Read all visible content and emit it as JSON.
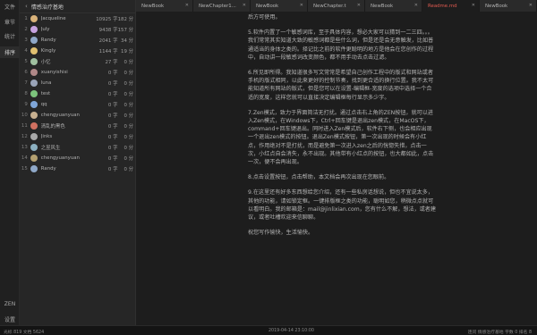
{
  "rail": {
    "items": [
      "文件",
      "章节",
      "统计",
      "排序"
    ],
    "bottom": [
      "ZEN",
      "设置"
    ]
  },
  "panel": {
    "title": "情感治疗基地",
    "rows": [
      {
        "n": "1",
        "name": "Jacqueline",
        "count": "10925 字",
        "time": "182 分",
        "color": "#d9b27a"
      },
      {
        "n": "2",
        "name": "July",
        "count": "9438 字",
        "time": "157 分",
        "color": "#c7a3e0"
      },
      {
        "n": "3",
        "name": "Randy",
        "count": "2041 字",
        "time": "34 分",
        "color": "#8fa8c8"
      },
      {
        "n": "4",
        "name": "Kingly",
        "count": "1144 字",
        "time": "19 分",
        "color": "#e0c070"
      },
      {
        "n": "5",
        "name": "小忆",
        "count": "27 字",
        "time": "0 分",
        "color": "#a0c0a0"
      },
      {
        "n": "6",
        "name": "xuanyishisi",
        "count": "0 字",
        "time": "0 分",
        "color": "#b08888"
      },
      {
        "n": "7",
        "name": "luna",
        "count": "0 字",
        "time": "0 分",
        "color": "#9aa4b8"
      },
      {
        "n": "8",
        "name": "test",
        "count": "0 字",
        "time": "0 分",
        "color": "#7cc37c"
      },
      {
        "n": "9",
        "name": "qq",
        "count": "0 字",
        "time": "0 分",
        "color": "#7fa6d8"
      },
      {
        "n": "10",
        "name": "chengyuanyuan",
        "count": "0 字",
        "time": "0 分",
        "color": "#c8b090"
      },
      {
        "n": "11",
        "name": "清乱的黑色",
        "count": "0 字",
        "time": "0 分",
        "color": "#d07060"
      },
      {
        "n": "12",
        "name": "Jinks",
        "count": "0 字",
        "time": "0 分",
        "color": "#a8a8a8"
      },
      {
        "n": "13",
        "name": "之昱风生",
        "count": "0 字",
        "time": "0 分",
        "color": "#8cb0c0"
      },
      {
        "n": "14",
        "name": "chengyuanyuan",
        "count": "0 字",
        "time": "0 分",
        "color": "#b4a070"
      },
      {
        "n": "15",
        "name": "Randy",
        "count": "0 字",
        "time": "0 分",
        "color": "#8fa8c8"
      }
    ]
  },
  "tabs": [
    "NewBook",
    "NewChapter1...",
    "NewBook",
    "NewChapter.t",
    "NewBook",
    "Readme.md",
    "NewBook"
  ],
  "editor": {
    "paragraphs": [
      "后方可使用。",
      "5.软件内置了一个敏感词库，至于具体内容，想必大家可以猜到一二三四。。。我们常常其实知道大致的敏感词都是些什么词，但是还是会无意触发，比如普通适当的身体之类的。择记比之前的软件更聪明的地方是他会在您创作的过程中，自动讲一段敏感词改变颜色，都不用手动去点击过滤。",
      "6.所见即所得。我知道很多写文常常是希望自己创作工程中的版式和网站或者手机的版式相同，以此来更好的控制节奏，找到更合适的换行位置。我不太可能知道所有网站的版式，但是您可以在设置-编辑框-宽度的选项中选择一个合适的宽度，这样您就可以直接决定编辑框每行显示多少字。",
      "7.Zen模式，致力于界面简洁无打扰。通过点击右上角的ZEN按钮，就可以进入Zen模式，在Windows下，Ctrl+回车键是退出zen模式，在MacOS下，command+回车键退出。同时进入Zen模式后，软件右下侧，也会相应出现一个退出zen模式的按钮。退出Zen模式按钮，第一次出现的时候会有小红点，作用绝对不是打扰，而是避免第一次进入zen之后的恍惚失措，点击一次，小红点自会消失，永不出现。其他带有小红点的按钮，也大都如此，点击一次，便不会再出现。",
      "8.点击设置按钮，点击帮助，本文档会再次出现在您眼前。",
      "9.在这里还有好多东西想给您介绍，还有一些私房话想说，但也不宜说太多，其他的功能，请如锁定框。一键排版框之类的功能，聪明如您，稍微点点就可以看明白。我的邮箱是：mail@jinlixian.com，您有什么不解，想法，或者建议，或者吐槽欢迎来信聊聊。",
      "祝您写作愉快，生活愉快。"
    ]
  },
  "status": {
    "left": "光标 819  文档 5624",
    "center": "2019-04-14 23:10:00",
    "right": "连问 情感治疗基地 字数 0 排名 8"
  },
  "colors": {
    "accent": "#e05a50"
  }
}
